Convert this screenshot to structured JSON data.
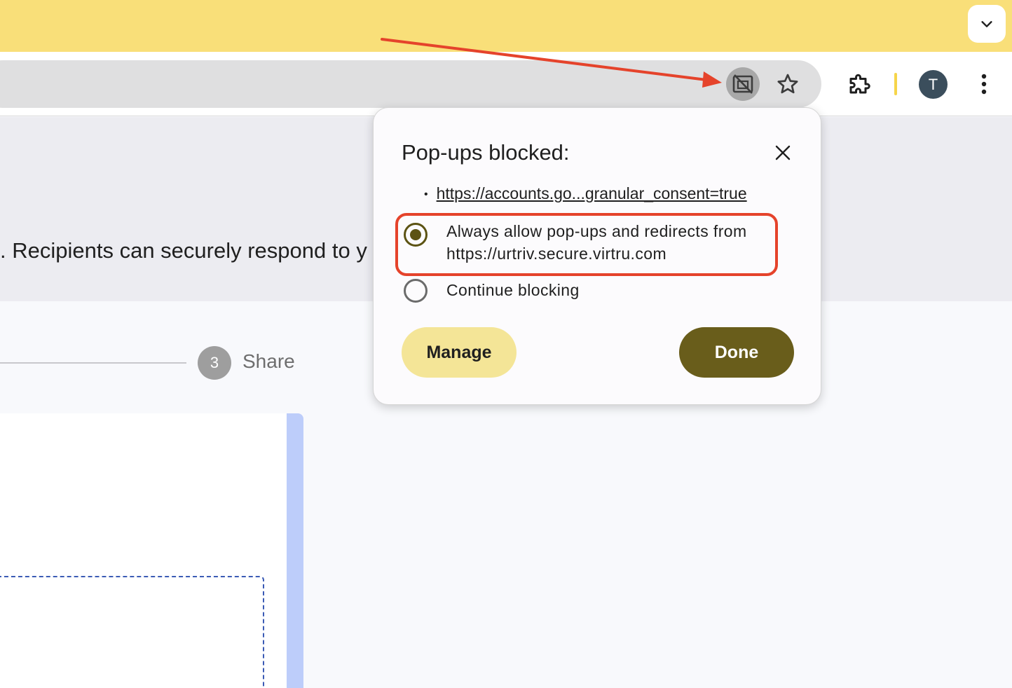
{
  "browser": {
    "avatar_initial": "T",
    "icons": {
      "tab_search": "chevron-down-icon",
      "popup_blocked": "popup-blocked-icon",
      "bookmark": "star-icon",
      "extensions": "puzzle-icon",
      "menu": "more-vertical-icon"
    },
    "colors": {
      "title_strip": "#f9df79",
      "omnibox": "#dfdfe0"
    }
  },
  "page": {
    "banner_text": ". Recipients can securely respond to y",
    "step": {
      "number": "3",
      "label": "Share"
    }
  },
  "popup_bubble": {
    "title": "Pop-ups blocked:",
    "blocked_items": [
      "https://accounts.go...granular_consent=true"
    ],
    "options": [
      {
        "line1": "Always allow pop-ups and redirects from",
        "line2": "https://urtriv.secure.virtru.com",
        "selected": true
      },
      {
        "line1": "Continue blocking",
        "selected": false
      }
    ],
    "manage_label": "Manage",
    "done_label": "Done",
    "colors": {
      "done_button": "#695d1b",
      "manage_button": "#f4e597"
    }
  },
  "annotations": {
    "color": "#e5432b"
  }
}
